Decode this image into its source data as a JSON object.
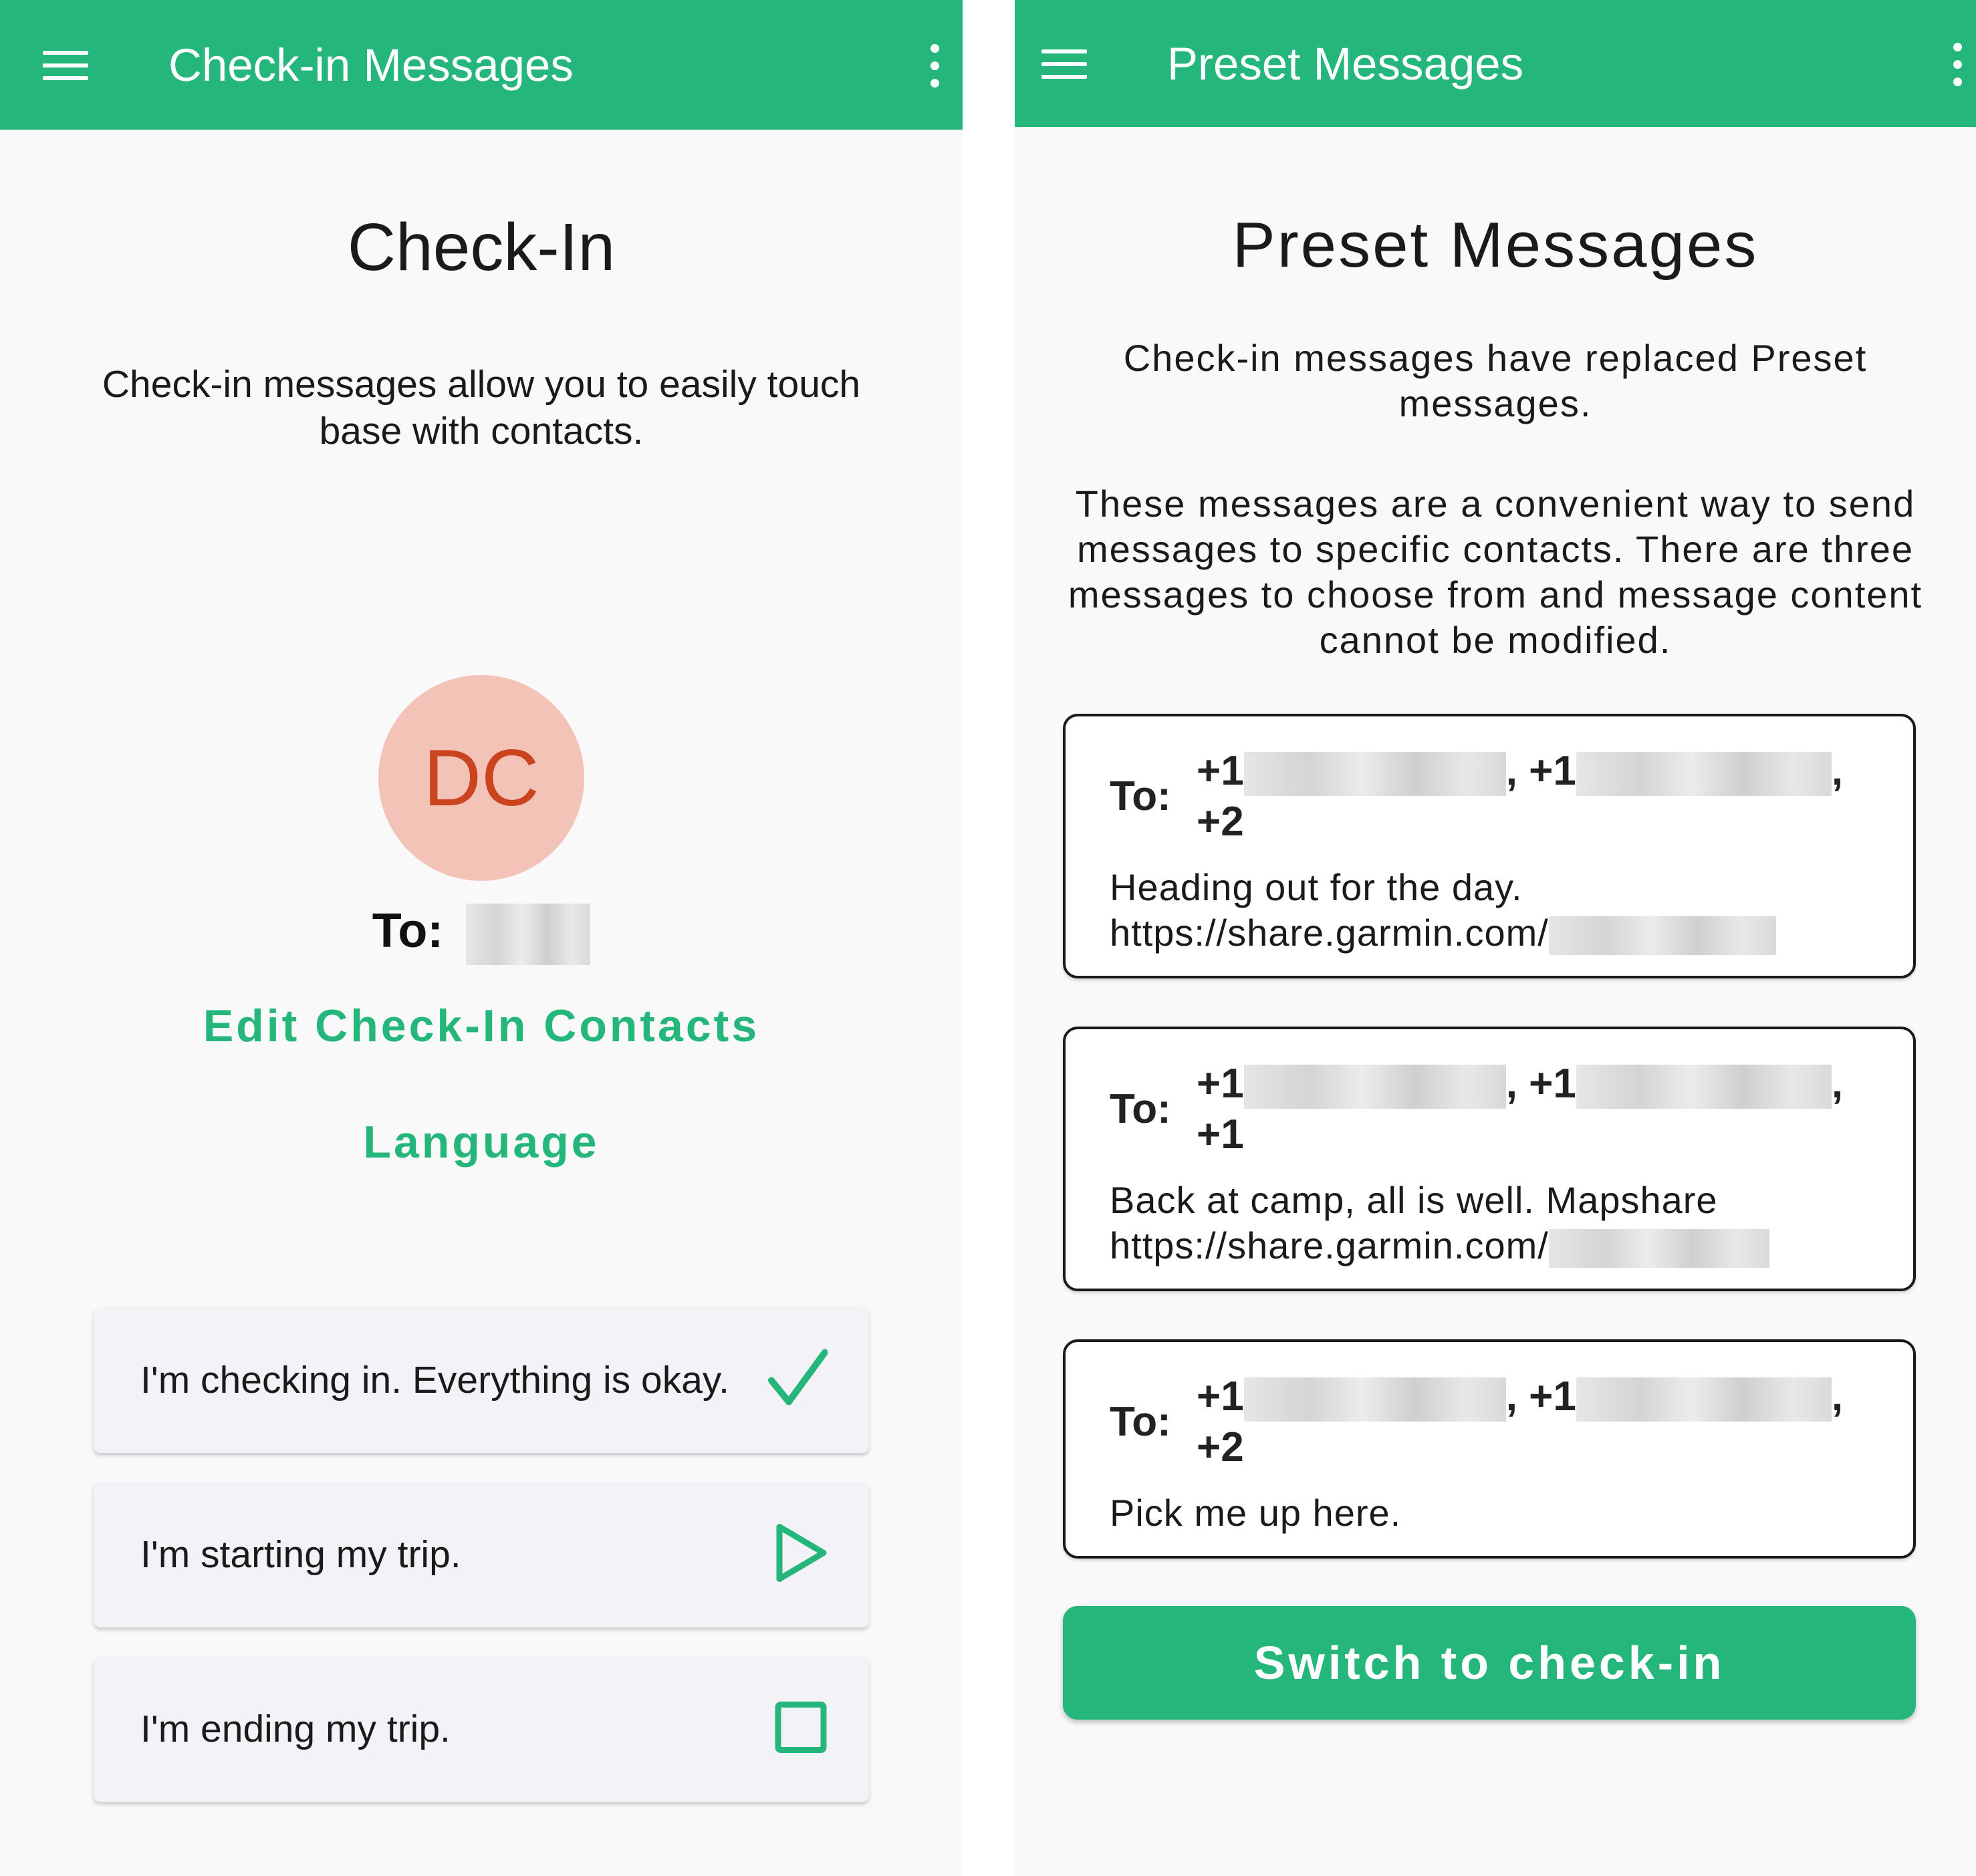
{
  "colors": {
    "brand_green": "#24b67b",
    "avatar_bg": "#f3c3b8",
    "avatar_text": "#c9441f",
    "card_bg": "#f2f2f7"
  },
  "left": {
    "appbar": {
      "title": "Check-in Messages",
      "menu_icon": "hamburger-menu-icon",
      "overflow_icon": "more-vert-icon"
    },
    "heading": "Check-In",
    "description": "Check-in messages allow you to easily touch base with contacts.",
    "avatar_initials": "DC",
    "to_label": "To:",
    "edit_contacts_label": "Edit Check-In Contacts",
    "language_label": "Language",
    "messages": [
      {
        "text": "I'm checking in. Everything is okay.",
        "icon": "checkmark-icon"
      },
      {
        "text": "I'm starting my trip.",
        "icon": "play-icon"
      },
      {
        "text": "I'm ending my trip.",
        "icon": "stop-icon"
      }
    ]
  },
  "right": {
    "appbar": {
      "title": "Preset Messages",
      "menu_icon": "hamburger-menu-icon",
      "overflow_icon": "more-vert-icon"
    },
    "heading": "Preset Messages",
    "desc1": "Check-in messages have replaced Preset messages.",
    "desc2": "These messages are a convenient way to send messages to specific contacts. There are three messages to choose from and message content cannot be modified.",
    "presets": [
      {
        "to_label": "To:",
        "r1": "+1",
        "r2": "+1",
        "more": "+2",
        "body1": "Heading out for the day.",
        "body2": "https://share.garmin.com/"
      },
      {
        "to_label": "To:",
        "r1": "+1",
        "r2": "+1",
        "more": "+1",
        "body1": "Back at camp, all is well. Mapshare",
        "body2": "https://share.garmin.com/"
      },
      {
        "to_label": "To:",
        "r1": "+1",
        "r2": "+1",
        "more": "+2",
        "body1": "Pick me up here.",
        "body2": ""
      }
    ],
    "switch_button": "Switch to check-in"
  }
}
